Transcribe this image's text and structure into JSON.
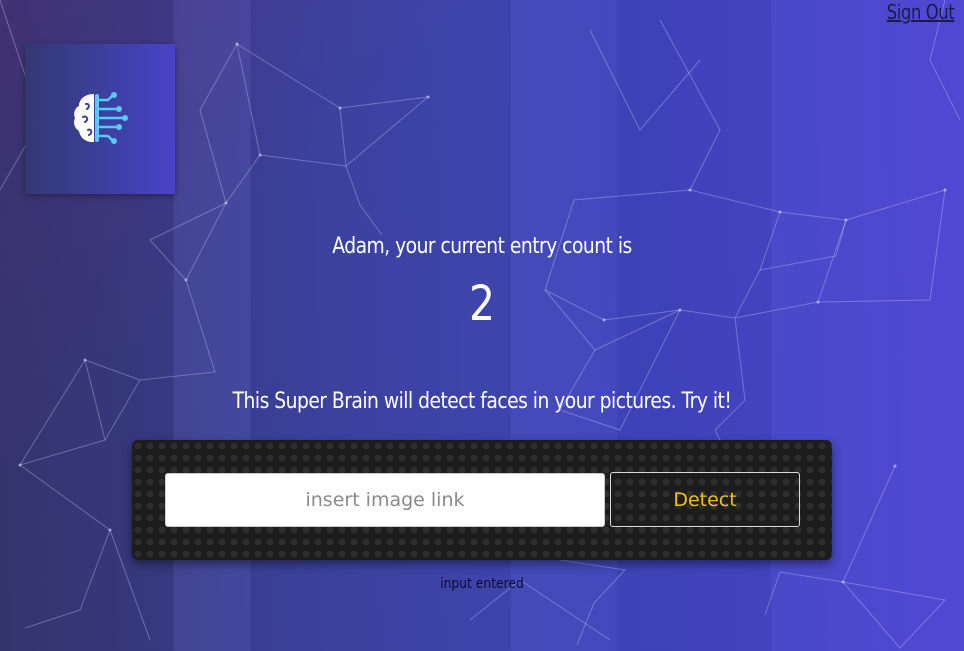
{
  "nav": {
    "signout_label": "Sign Out"
  },
  "logo": {
    "icon": "brain-circuit-icon"
  },
  "rank": {
    "greeting": "Adam, your current entry count is",
    "entry_count": "2"
  },
  "intro": {
    "tagline": "This Super Brain will detect faces in your pictures. Try it!"
  },
  "form": {
    "input_value": "",
    "input_placeholder": "insert image link",
    "detect_label": "Detect"
  },
  "status": {
    "message": "input entered"
  },
  "colors": {
    "accent": "#f2c01e",
    "background_start": "#3a3a78",
    "background_end": "#4e44d2",
    "panel": "#1d1d1d"
  }
}
